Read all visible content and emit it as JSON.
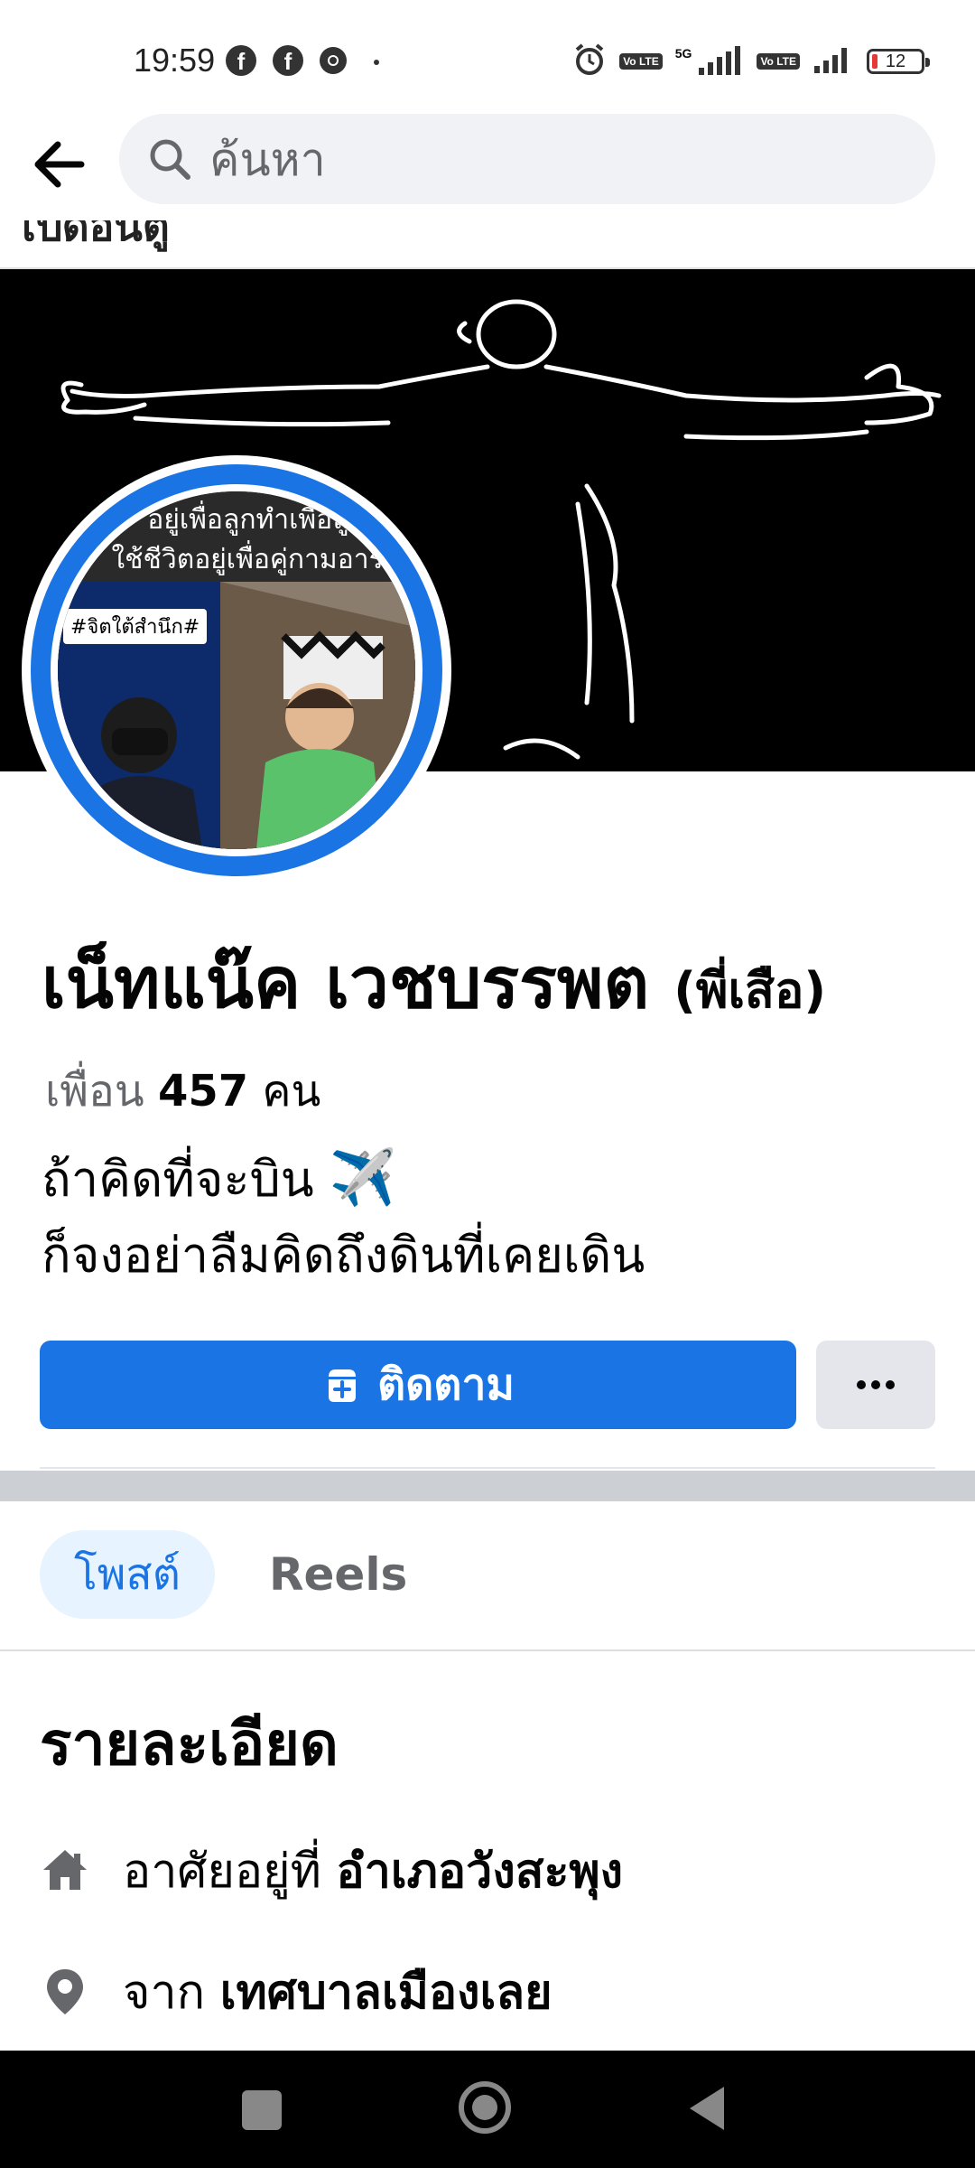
{
  "status_bar": {
    "time": "19:59",
    "app_icons": [
      "facebook-icon",
      "facebook-icon",
      "chrome-icon"
    ],
    "network": "5G",
    "volte1": "Vo LTE",
    "volte2": "Vo LTE",
    "battery": "12",
    "battery_color": "#e53935"
  },
  "search": {
    "placeholder": "ค้นหา"
  },
  "peek_text": "เปิดอันตู",
  "profile": {
    "name": "เน็ทแน๊ค เวชบรรพต",
    "nickname": "(พี่เสือ)",
    "friends_label": "เพื่อน",
    "friends_count": "457",
    "friends_unit": "คน",
    "bio_line1": "ถ้าคิดที่จะบิน",
    "bio_emoji": "✈️",
    "bio_line2": "ก็จงอย่าลืมคิดถึงดินที่เคยเดิน",
    "avatar_caption1": "อยู่เพื่อลูกทำเพื่อลูก",
    "avatar_caption2": "ใช้ชีวิตอยู่เพื่อคู่กามอารม",
    "avatar_tag": "#จิตใต้สำนึก#"
  },
  "actions": {
    "follow_label": "ติดตาม",
    "more_label": "..."
  },
  "tabs": [
    {
      "label": "โพสต์",
      "active": true
    },
    {
      "label": "Reels",
      "active": false
    }
  ],
  "details": {
    "title": "รายละเอียด",
    "rows": [
      {
        "icon": "home-icon",
        "prefix": "อาศัยอยู่ที่",
        "value": "อำเภอวังสะพุง"
      },
      {
        "icon": "location-pin-icon",
        "prefix": "จาก",
        "value": "เทศบาลเมืองเลย"
      }
    ]
  },
  "colors": {
    "brand_blue": "#1b74e4",
    "active_tab_bg": "#e7f3ff",
    "secondary_btn": "#e4e6eb"
  }
}
